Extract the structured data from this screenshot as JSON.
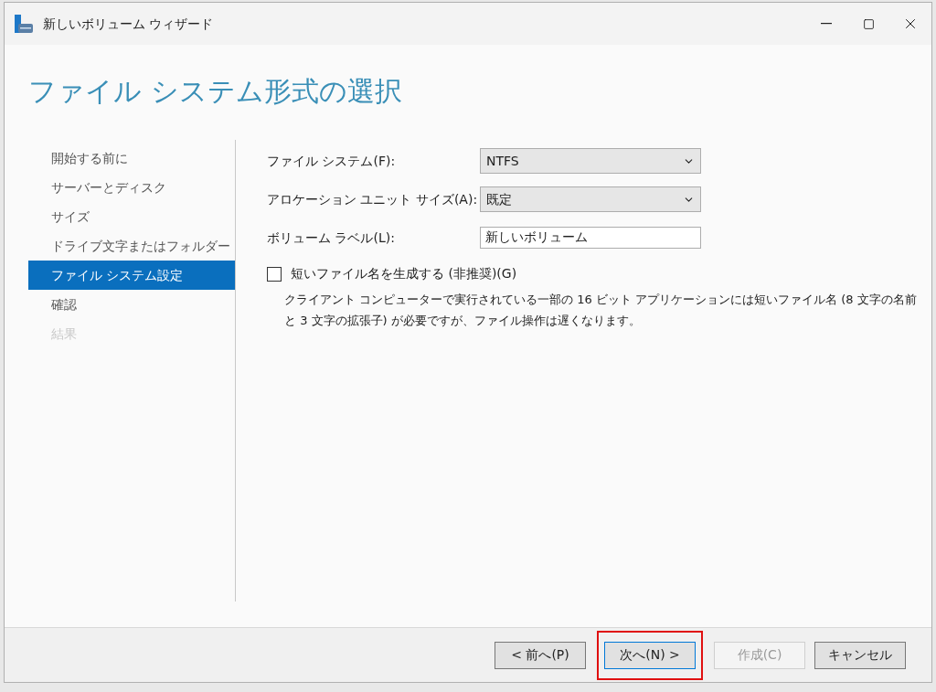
{
  "window": {
    "title": "新しいボリューム ウィザード"
  },
  "heading": "ファイル システム形式の選択",
  "steps": [
    {
      "label": "開始する前に",
      "selected": false,
      "disabled": false
    },
    {
      "label": "サーバーとディスク",
      "selected": false,
      "disabled": false
    },
    {
      "label": "サイズ",
      "selected": false,
      "disabled": false
    },
    {
      "label": "ドライブ文字またはフォルダー",
      "selected": false,
      "disabled": false
    },
    {
      "label": "ファイル システム設定",
      "selected": true,
      "disabled": false
    },
    {
      "label": "確認",
      "selected": false,
      "disabled": false
    },
    {
      "label": "結果",
      "selected": false,
      "disabled": true
    }
  ],
  "fields": [
    {
      "kind": "select",
      "label": "ファイル システム(F):",
      "value": "NTFS"
    },
    {
      "kind": "select",
      "label": "アロケーション ユニット サイズ(A):",
      "value": "既定"
    },
    {
      "kind": "text",
      "label": "ボリューム ラベル(L):",
      "value": "新しいボリューム"
    }
  ],
  "checkbox": {
    "label": "短いファイル名を生成する (非推奨)(G)",
    "checked": false
  },
  "description": "クライアント コンピューターで実行されている一部の 16 ビット アプリケーションには短いファイル名 (8 文字の名前と 3 文字の拡張子) が必要ですが、ファイル操作は遅くなります。",
  "buttons": [
    {
      "label": "< 前へ(P)",
      "disabled": false,
      "focused": false,
      "highlighted": false
    },
    {
      "label": "次へ(N) >",
      "disabled": false,
      "focused": true,
      "highlighted": true
    },
    {
      "label": "作成(C)",
      "disabled": true,
      "focused": false,
      "highlighted": false
    },
    {
      "label": "キャンセル",
      "disabled": false,
      "focused": false,
      "highlighted": false
    }
  ]
}
